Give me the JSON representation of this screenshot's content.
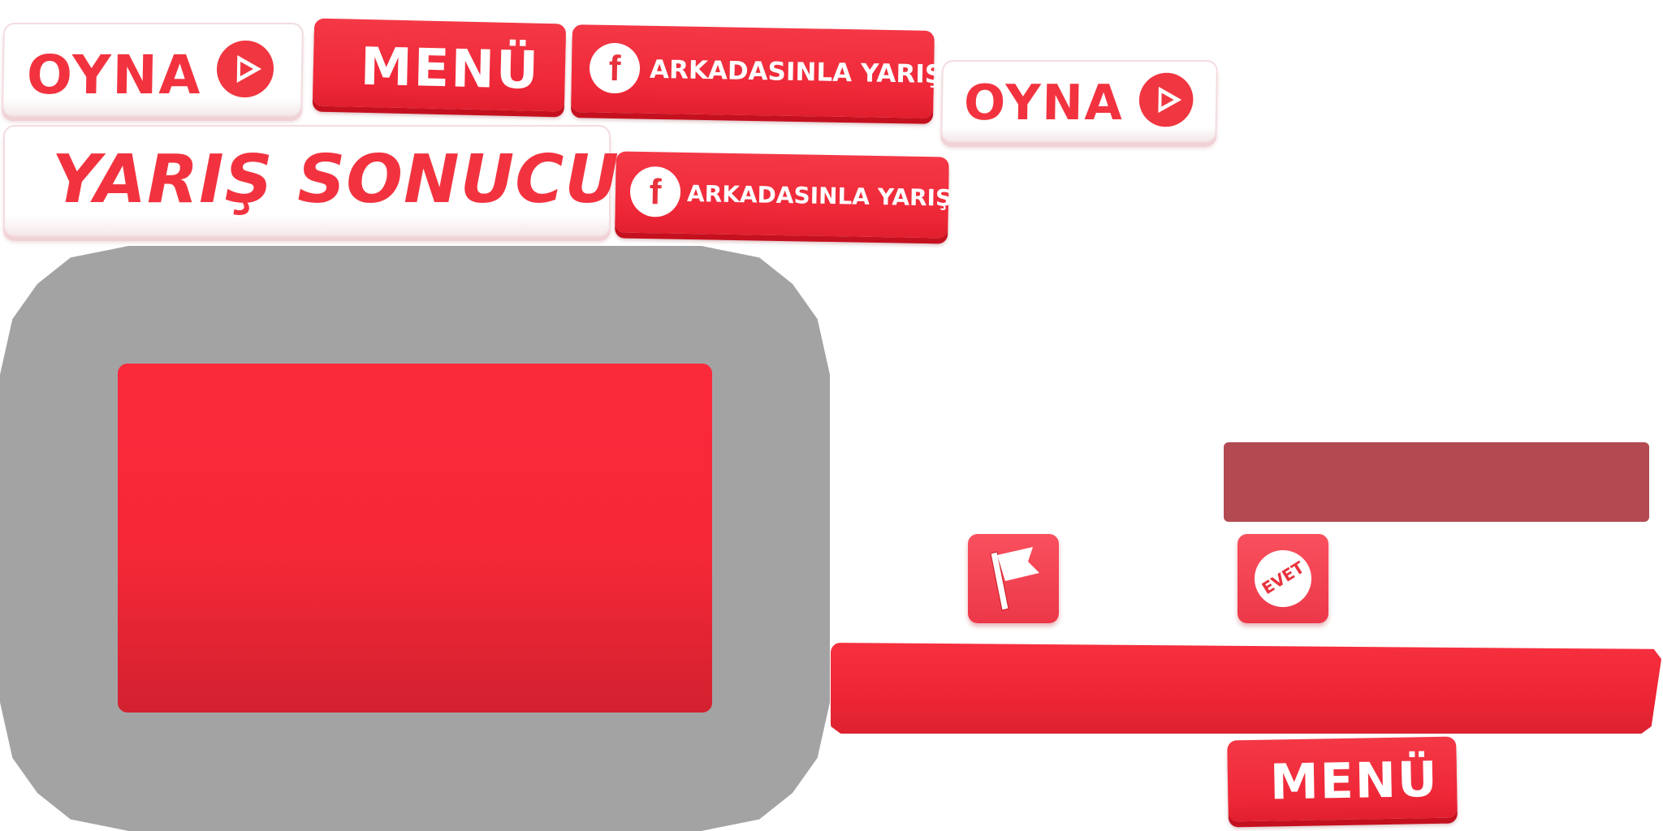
{
  "buttons": {
    "play_label": "OYNA",
    "menu_label": "MENÜ",
    "facebook_label": "ARKADASINLA YARIŞ",
    "race_result_label": "YARIŞ SONUCU",
    "yes_label": "EVET"
  },
  "icons": {
    "play": "play-icon",
    "facebook": "facebook-icon",
    "flag": "flag-icon",
    "yes": "yes-stamp-icon"
  },
  "colors": {
    "brand_red": "#f0323f",
    "dark_red": "#b34a52",
    "panel_gray": "#a3a3a3"
  }
}
